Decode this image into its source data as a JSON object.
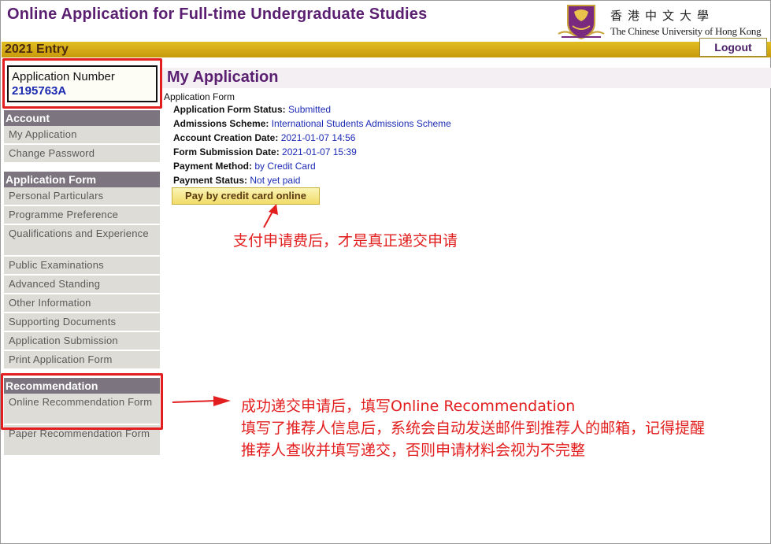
{
  "header": {
    "title": "Online Application for Full-time Undergraduate Studies",
    "entry": "2021 Entry",
    "logout_label": "Logout",
    "university_zh": "香港中文大學",
    "university_en": "The Chinese University of Hong Kong"
  },
  "sidebar": {
    "application_number_label": "Application Number",
    "application_number": "2195763A",
    "sections": [
      {
        "heading": "Account",
        "items": [
          "My Application",
          "Change Password"
        ]
      },
      {
        "heading": "Application Form",
        "items": [
          "Personal Particulars",
          "Programme Preference",
          "Qualifications and Experience",
          "Public Examinations",
          "Advanced Standing",
          "Other Information",
          "Supporting Documents",
          "Application Submission",
          "Print Application Form"
        ]
      },
      {
        "heading": "Recommendation",
        "items": [
          "Online Recommendation Form",
          "Paper Recommendation Form"
        ]
      }
    ]
  },
  "main": {
    "page_title": "My Application",
    "section_label": "Application Form",
    "fields": [
      {
        "key": "Application Form Status:",
        "value": "Submitted"
      },
      {
        "key": "Admissions Scheme:",
        "value": "International Students Admissions Scheme"
      },
      {
        "key": "Account Creation Date:",
        "value": "2021-01-07 14:56"
      },
      {
        "key": "Form Submission Date:",
        "value": "2021-01-07 15:39"
      },
      {
        "key": "Payment Method:",
        "value": "by Credit Card"
      },
      {
        "key": "Payment Status:",
        "value": "Not yet paid"
      }
    ],
    "pay_button_label": "Pay by credit card online"
  },
  "annotations": {
    "payment_note": "支付申请费后，才是真正递交申请",
    "recommendation_note_1": "成功递交申请后，填写Online Recommendation",
    "recommendation_note_2": "填写了推荐人信息后，系统会自动发送邮件到推荐人的邮箱，记得提醒",
    "recommendation_note_3": "推荐人查收并填写递交，否则申请材料会视为不完整"
  },
  "colors": {
    "title_purple": "#5a1f70",
    "entry_gold": "#d4aa14",
    "link_blue": "#1c2bb5",
    "annotation_red": "#e31e1e"
  }
}
